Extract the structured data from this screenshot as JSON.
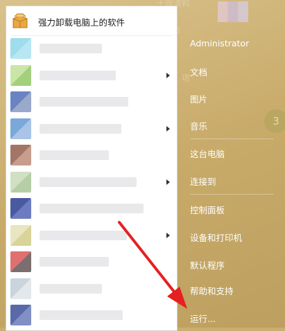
{
  "background": {
    "hint_top": "十提清料",
    "hint_side1": "出",
    "hint_side2": "项",
    "circle_label": "3"
  },
  "start_menu": {
    "first_program": {
      "label": "强力卸载电脑上的软件",
      "icon": "package-box-icon"
    },
    "programs": [
      {
        "icon_colors": [
          "#9fdcec",
          "#b8e7f3"
        ],
        "text_width": 90,
        "has_submenu": false
      },
      {
        "icon_colors": [
          "#c9e6a6",
          "#a4d07e"
        ],
        "text_width": 110,
        "has_submenu": true
      },
      {
        "icon_colors": [
          "#6a84c2",
          "#9aa8cc"
        ],
        "text_width": 128,
        "has_submenu": false
      },
      {
        "icon_colors": [
          "#7aa8d8",
          "#a9c4e8"
        ],
        "text_width": 118,
        "has_submenu": true
      },
      {
        "icon_colors": [
          "#a27566",
          "#c79e8e"
        ],
        "text_width": 100,
        "has_submenu": false
      },
      {
        "icon_colors": [
          "#cfe0c4",
          "#b6cea6"
        ],
        "text_width": 140,
        "has_submenu": true
      },
      {
        "icon_colors": [
          "#4a5aa0",
          "#6d7cc0"
        ],
        "text_width": 150,
        "has_submenu": false
      },
      {
        "icon_colors": [
          "#e9e5c0",
          "#d8d49a"
        ],
        "text_width": 126,
        "has_submenu": true
      },
      {
        "icon_colors": [
          "#e07070",
          "#7a6e6e"
        ],
        "text_width": 100,
        "has_submenu": false
      },
      {
        "icon_colors": [
          "#c9d4dc",
          "#e3e8ec"
        ],
        "text_width": 90,
        "has_submenu": false
      },
      {
        "icon_colors": [
          "#5a6aa8",
          "#8090c4"
        ],
        "text_width": 120,
        "has_submenu": false
      }
    ],
    "right_items": [
      {
        "label": "Administrator",
        "name": "user-name"
      },
      {
        "label": "文档",
        "name": "right-item-documents"
      },
      {
        "label": "图片",
        "name": "right-item-pictures"
      },
      {
        "label": "音乐",
        "name": "right-item-music"
      },
      {
        "label": "这台电脑",
        "name": "right-item-this-pc"
      },
      {
        "label": "连接到",
        "name": "right-item-connect-to"
      },
      {
        "label": "控制面板",
        "name": "right-item-control-panel"
      },
      {
        "label": "设备和打印机",
        "name": "right-item-devices-printers"
      },
      {
        "label": "默认程序",
        "name": "right-item-default-programs"
      },
      {
        "label": "帮助和支持",
        "name": "right-item-help-support"
      },
      {
        "label": "运行...",
        "name": "right-item-run"
      }
    ]
  },
  "colors": {
    "menu_right_bg": "#c9ae70",
    "annotation_arrow": "#e62020"
  }
}
